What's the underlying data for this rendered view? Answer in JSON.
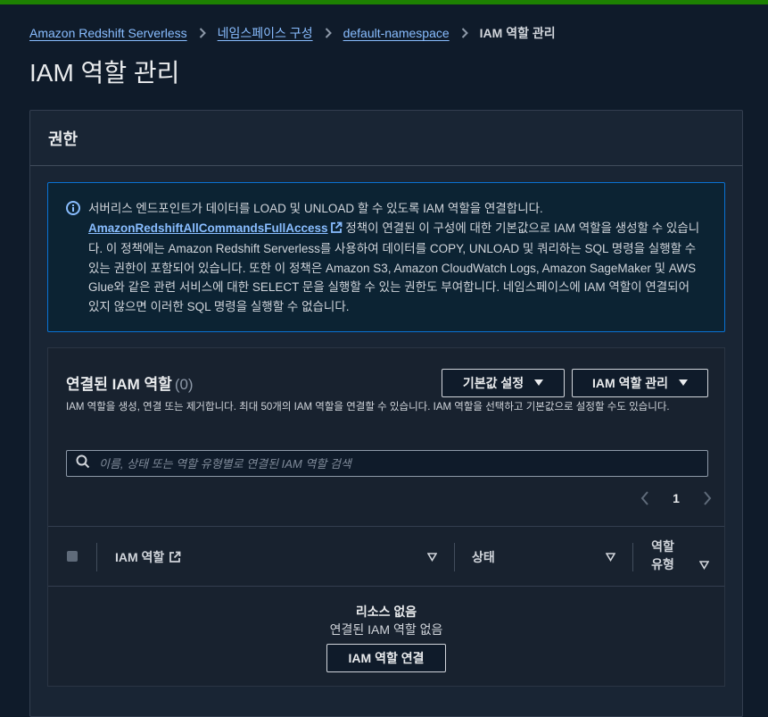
{
  "breadcrumb": {
    "items": [
      {
        "label": "Amazon Redshift Serverless"
      },
      {
        "label": "네임스페이스 구성"
      },
      {
        "label": "default-namespace"
      }
    ],
    "current": "IAM 역할 관리"
  },
  "page_title": "IAM 역할 관리",
  "permissions": {
    "header": "권한",
    "alert": {
      "line1": "서버리스 엔드포인트가 데이터를 LOAD 및 UNLOAD 할 수 있도록 IAM 역할을 연결합니다.",
      "link": "AmazonRedshiftAllCommandsFullAccess",
      "rest": " 정책이 연결된 이 구성에 대한 기본값으로 IAM 역할을 생성할 수 있습니다. 이 정책에는 Amazon Redshift Serverless를 사용하여 데이터를 COPY, UNLOAD 및 쿼리하는 SQL 명령을 실행할 수 있는 권한이 포함되어 있습니다. 또한 이 정책은 Amazon S3, Amazon CloudWatch Logs, Amazon SageMaker 및 AWS Glue와 같은 관련 서비스에 대한 SELECT 문을 실행할 수 있는 권한도 부여합니다. 네임스페이스에 IAM 역할이 연결되어 있지 않으면 이러한 SQL 명령을 실행할 수 없습니다."
    }
  },
  "roles_table": {
    "title": "연결된 IAM 역할",
    "count": "(0)",
    "default_button": "기본값 설정",
    "manage_button": "IAM 역할 관리",
    "description": "IAM 역할을 생성, 연결 또는 제거합니다. 최대 50개의 IAM 역할을 연결할 수 있습니다. IAM 역할을 선택하고 기본값으로 설정할 수도 있습니다.",
    "search_placeholder": "이름, 상태 또는 역할 유형별로 연결된 IAM 역할 검색",
    "page": "1",
    "columns": {
      "role": "IAM 역할",
      "status": "상태",
      "type_line1": "역할",
      "type_line2": "유형"
    },
    "empty": {
      "title": "리소스 없음",
      "subtitle": "연결된 IAM 역할 없음",
      "button": "IAM 역할 연결"
    }
  },
  "colors": {
    "background": "#0f1b2a",
    "panel": "#192534",
    "link": "#89bdff",
    "info_border": "#0972d3",
    "top_bar": "#1d8102"
  }
}
